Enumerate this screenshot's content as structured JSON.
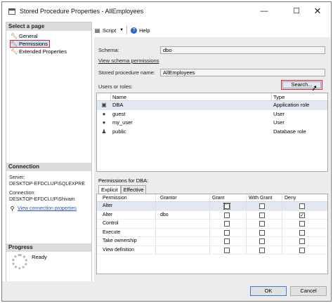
{
  "window": {
    "title": "Stored Procedure Properties - AllEmployees",
    "minimize": "—",
    "maximize": "☐",
    "close": "✕"
  },
  "left": {
    "select_page": "Select a page",
    "pages": [
      {
        "label": "General",
        "icon": "wrench-icon"
      },
      {
        "label": "Permissions",
        "icon": "wrench-icon"
      },
      {
        "label": "Extended Properties",
        "icon": "wrench-icon"
      }
    ],
    "connection": {
      "header": "Connection",
      "server_label": "Server:",
      "server_value": "DESKTOP-EFDCLUP\\SQLEXPRE",
      "connection_label": "Connection:",
      "connection_value": "DESKTOP-EFDCLUP\\Shivam",
      "view_props_link": "View connection properties"
    },
    "progress": {
      "header": "Progress",
      "status": "Ready"
    }
  },
  "toolbar": {
    "script_label": "Script",
    "help_label": "Help"
  },
  "form": {
    "schema_label": "Schema:",
    "schema_value": "dbo",
    "view_schema_link": "View schema permissions",
    "sp_name_label": "Stored procedure name:",
    "sp_name_value": "AllEmployees",
    "users_label": "Users or roles:",
    "search_label": "Search..."
  },
  "users_grid": {
    "columns": [
      "Name",
      "Type"
    ],
    "rows": [
      {
        "name": "DBA",
        "type": "Application role",
        "icon": "app-role-icon"
      },
      {
        "name": "guest",
        "type": "User",
        "icon": "user-icon"
      },
      {
        "name": "my_user",
        "type": "User",
        "icon": "user-icon"
      },
      {
        "name": "public",
        "type": "Database role",
        "icon": "db-role-icon"
      }
    ]
  },
  "permissions": {
    "title": "Permissions for DBA:",
    "tabs": [
      "Explicit",
      "Effective"
    ],
    "columns": [
      "Permission",
      "Grantor",
      "Grant",
      "With Grant",
      "Deny"
    ],
    "rows": [
      {
        "permission": "Alter",
        "grantor": "",
        "grant": false,
        "with_grant": false,
        "deny": false
      },
      {
        "permission": "Alter",
        "grantor": "dbo",
        "grant": false,
        "with_grant": false,
        "deny": true
      },
      {
        "permission": "Control",
        "grantor": "",
        "grant": false,
        "with_grant": false,
        "deny": false
      },
      {
        "permission": "Execute",
        "grantor": "",
        "grant": false,
        "with_grant": false,
        "deny": false
      },
      {
        "permission": "Take ownership",
        "grantor": "",
        "grant": false,
        "with_grant": false,
        "deny": false
      },
      {
        "permission": "View definition",
        "grantor": "",
        "grant": false,
        "with_grant": false,
        "deny": false
      }
    ]
  },
  "footer": {
    "ok": "OK",
    "cancel": "Cancel"
  }
}
